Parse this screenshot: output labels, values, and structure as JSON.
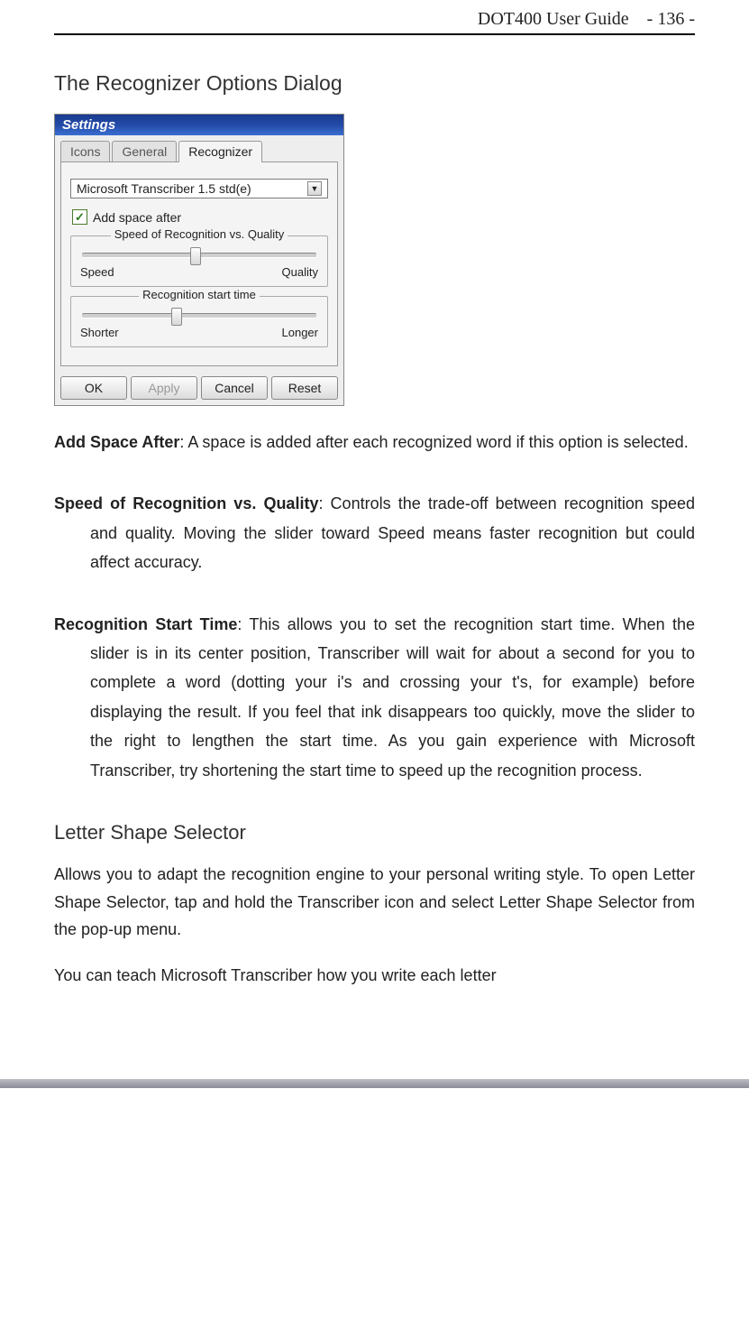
{
  "header": {
    "title_left": "DOT400 User Guide",
    "page_label": "- 136 -"
  },
  "sections": {
    "recognizer_title": "The Recognizer Options Dialog",
    "letter_title": "Letter Shape Selector"
  },
  "screenshot": {
    "window_title": "Settings",
    "tabs": {
      "icons": "Icons",
      "general": "General",
      "recognizer": "Recognizer"
    },
    "dropdown_value": "Microsoft Transcriber 1.5 std(e)",
    "checkbox_label": "Add space after",
    "slider1": {
      "legend": "Speed of Recognition vs. Quality",
      "left": "Speed",
      "right": "Quality"
    },
    "slider2": {
      "legend": "Recognition start time",
      "left": "Shorter",
      "right": "Longer"
    },
    "buttons": {
      "ok": "OK",
      "apply": "Apply",
      "cancel": "Cancel",
      "reset": "Reset"
    }
  },
  "definitions": {
    "add_space": {
      "term": "Add Space After",
      "text": ": A space is added after each recognized word if this option is selected."
    },
    "speed": {
      "term": "Speed of Recognition vs. Quality",
      "text": ": Controls the trade-off between recognition speed and quality. Moving the slider toward Speed means faster recognition but could affect accuracy."
    },
    "start_time": {
      "term": "Recognition Start Time",
      "text": ": This allows you to set the recognition start time. When the slider is in its center position, Transcriber will wait for about a second for you to complete a word (dotting your i's and crossing your t's, for example) before displaying the result. If you feel that ink disappears too quickly, move the slider to the right to lengthen the start time. As you gain experience with Microsoft Transcriber, try shortening the start time to speed up the recognition process."
    }
  },
  "letter_paragraphs": {
    "p1": "Allows you to adapt the recognition engine to your personal writing style. To open Letter Shape Selector, tap and hold the Transcriber icon and select Letter Shape Selector from the pop-up menu.",
    "p2": "You can teach Microsoft Transcriber how you write each letter"
  }
}
